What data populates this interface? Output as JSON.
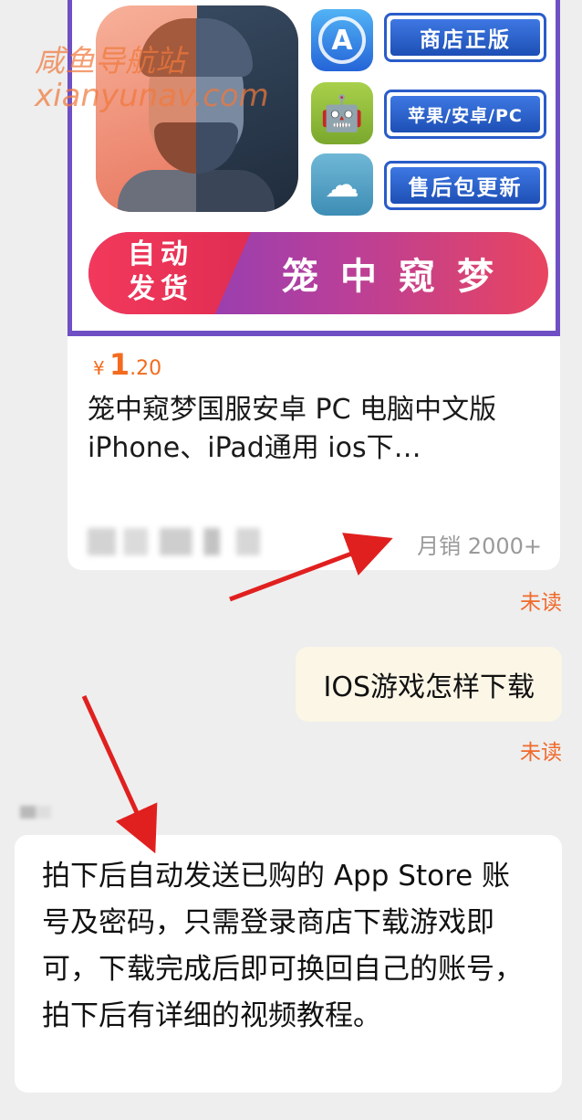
{
  "product": {
    "image": {
      "tags": [
        "商店正版",
        "苹果/安卓/PC",
        "售后包更新"
      ],
      "badge_line1": "自动",
      "badge_line2": "发货",
      "banner_title": "笼中窥梦",
      "platform_icons": [
        "app-store-icon",
        "android-icon",
        "cloud-sync-icon"
      ]
    },
    "price_currency": "¥",
    "price_int": "1",
    "price_dec": ".20",
    "title": "笼中窥梦国服安卓 PC 电脑中文版 iPhone、iPad通用 ios下…",
    "monthly_sales": "月销 2000+"
  },
  "watermark": {
    "line1": "咸鱼导航站",
    "line2": "xianyunav.com"
  },
  "messages": {
    "unread_label": "未读",
    "outgoing": "IOS游戏怎样下载",
    "incoming": "拍下后自动发送已购的 App Store 账号及密码，只需登录商店下载游戏即可，下载完成后即可换回自己的账号，拍下后有详细的视频教程。"
  },
  "colors": {
    "accent_orange": "#f36b1e",
    "unread_orange": "#f06a2c",
    "annotation_red": "#e0201f",
    "outgoing_bubble": "#fbf6e6"
  }
}
